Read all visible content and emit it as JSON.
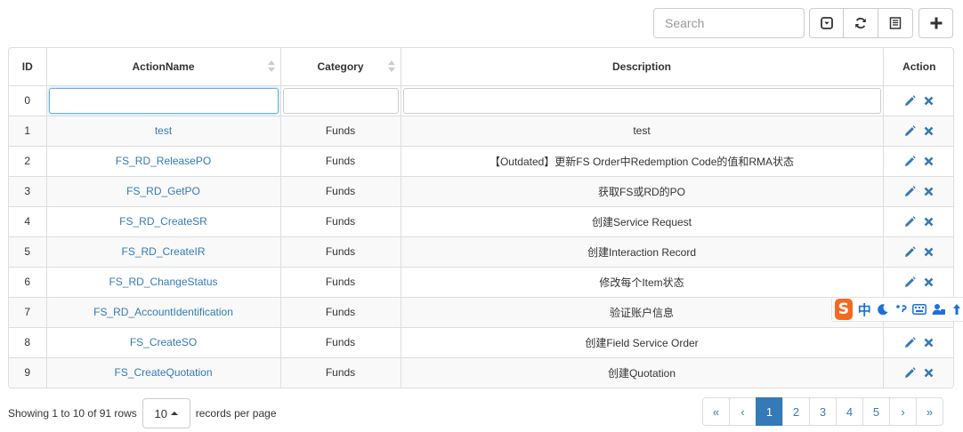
{
  "toolbar": {
    "search_placeholder": "Search",
    "buttons": [
      "toggle-view-icon",
      "refresh-icon",
      "columns-icon"
    ],
    "add_icon": "plus-icon"
  },
  "table": {
    "headers": [
      "ID",
      "ActionName",
      "Category",
      "Description",
      "Action"
    ],
    "filter_row_id": "0",
    "rows": [
      {
        "id": "1",
        "name": "test",
        "category": "Funds",
        "description": "test"
      },
      {
        "id": "2",
        "name": "FS_RD_ReleasePO",
        "category": "Funds",
        "description": "【Outdated】更新FS Order中Redemption Code的值和RMA状态"
      },
      {
        "id": "3",
        "name": "FS_RD_GetPO",
        "category": "Funds",
        "description": "获取FS或RD的PO"
      },
      {
        "id": "4",
        "name": "FS_RD_CreateSR",
        "category": "Funds",
        "description": "创建Service Request"
      },
      {
        "id": "5",
        "name": "FS_RD_CreateIR",
        "category": "Funds",
        "description": "创建Interaction Record"
      },
      {
        "id": "6",
        "name": "FS_RD_ChangeStatus",
        "category": "Funds",
        "description": "修改每个Item状态"
      },
      {
        "id": "7",
        "name": "FS_RD_AccountIdentification",
        "category": "Funds",
        "description": "验证账户信息"
      },
      {
        "id": "8",
        "name": "FS_CreateSO",
        "category": "Funds",
        "description": "创建Field Service Order"
      },
      {
        "id": "9",
        "name": "FS_CreateQuotation",
        "category": "Funds",
        "description": "创建Quotation"
      }
    ]
  },
  "ime": {
    "logo": "S",
    "mode": "中"
  },
  "footer": {
    "showing": "Showing 1 to 10 of 91 rows",
    "page_size": "10",
    "records_per_page": "records per page"
  },
  "pagination": {
    "first": "«",
    "prev": "‹",
    "pages": [
      "1",
      "2",
      "3",
      "4",
      "5"
    ],
    "active": "1",
    "next": "›",
    "last": "»"
  },
  "colors": {
    "link": "#337ab7",
    "active_page": "#337ab7",
    "ime_logo": "#f26a22"
  }
}
